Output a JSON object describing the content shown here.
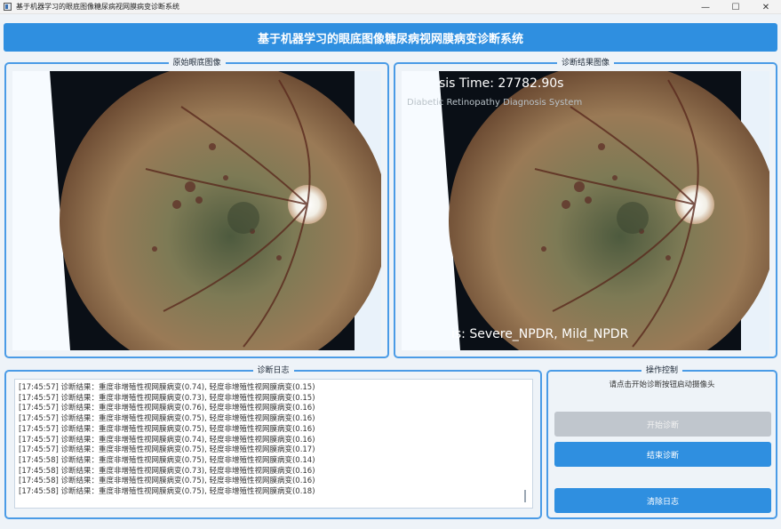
{
  "window": {
    "title": "基于机器学习的眼底图像糖尿病视网膜病变诊断系统",
    "minimize_glyph": "—",
    "maximize_glyph": "☐",
    "close_glyph": "✕"
  },
  "header": {
    "title": "基于机器学习的眼底图像糖尿病视网膜病变诊断系统"
  },
  "panels": {
    "original_title": "原始眼底图像",
    "result_title": "诊断结果图像",
    "result_overlay": {
      "time_text": "sis Time: 27782.90s",
      "subtitle_text": "Diabetic Retinopathy Diagnosis System",
      "diagnosis_text": "is: Severe_NPDR, Mild_NPDR"
    }
  },
  "log": {
    "title": "诊断日志",
    "entries": [
      "[17:45:57] 诊断结果：重度非增殖性视网膜病变(0.74), 轻度非增殖性视网膜病变(0.15)",
      "[17:45:57] 诊断结果：重度非增殖性视网膜病变(0.73), 轻度非增殖性视网膜病变(0.15)",
      "[17:45:57] 诊断结果：重度非增殖性视网膜病变(0.76), 轻度非增殖性视网膜病变(0.16)",
      "[17:45:57] 诊断结果：重度非增殖性视网膜病变(0.75), 轻度非增殖性视网膜病变(0.16)",
      "[17:45:57] 诊断结果：重度非增殖性视网膜病变(0.75), 轻度非增殖性视网膜病变(0.16)",
      "[17:45:57] 诊断结果：重度非增殖性视网膜病变(0.74), 轻度非增殖性视网膜病变(0.16)",
      "[17:45:57] 诊断结果：重度非增殖性视网膜病变(0.75), 轻度非增殖性视网膜病变(0.17)",
      "[17:45:58] 诊断结果：重度非增殖性视网膜病变(0.75), 轻度非增殖性视网膜病变(0.14)",
      "[17:45:58] 诊断结果：重度非增殖性视网膜病变(0.73), 轻度非增殖性视网膜病变(0.16)",
      "[17:45:58] 诊断结果：重度非增殖性视网膜病变(0.75), 轻度非增殖性视网膜病变(0.16)",
      "[17:45:58] 诊断结果：重度非增殖性视网膜病变(0.75), 轻度非增殖性视网膜病变(0.18)"
    ]
  },
  "controls": {
    "title": "操作控制",
    "hint": "请点击开始诊断按钮启动摄像头",
    "start_label": "开始诊断",
    "stop_label": "结束诊断",
    "clear_label": "清除日志"
  },
  "colors": {
    "accent": "#2f8fe0",
    "disabled": "#c0c6cd",
    "border": "#4a9be6"
  }
}
